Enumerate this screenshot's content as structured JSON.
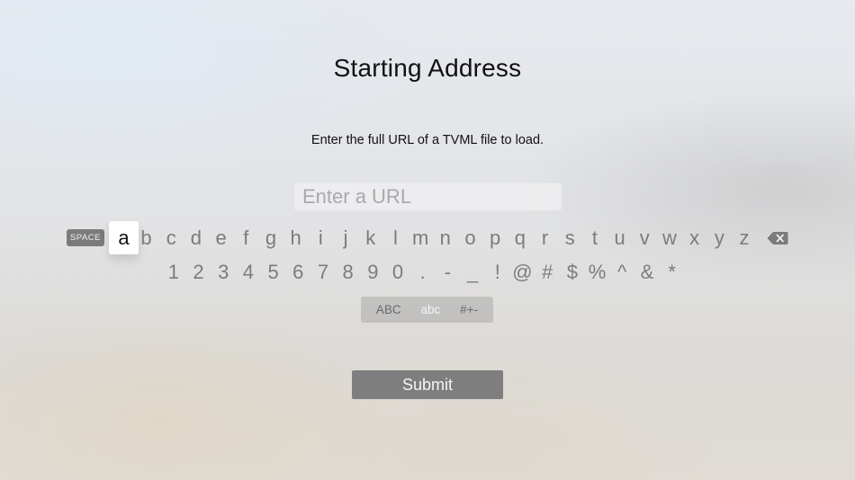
{
  "screen": {
    "title": "Starting Address",
    "instruction": "Enter the full URL of a TVML file to load."
  },
  "url_input": {
    "placeholder": "Enter a URL",
    "value": ""
  },
  "keyboard": {
    "space_label": "SPACE",
    "focused_key": "a",
    "letters": [
      "b",
      "c",
      "d",
      "e",
      "f",
      "g",
      "h",
      "i",
      "j",
      "k",
      "l",
      "m",
      "n",
      "o",
      "p",
      "q",
      "r",
      "s",
      "t",
      "u",
      "v",
      "w",
      "x",
      "y",
      "z"
    ],
    "symbols": [
      "1",
      "2",
      "3",
      "4",
      "5",
      "6",
      "7",
      "8",
      "9",
      "0",
      ".",
      "-",
      "_",
      "!",
      "@",
      "#",
      "$",
      "%",
      "^",
      "&",
      "*"
    ],
    "delete_icon": "backspace-icon",
    "modes": {
      "uppercase": "ABC",
      "lowercase": "abc",
      "symbols": "#+-",
      "active": "abc"
    }
  },
  "submit_label": "Submit"
}
